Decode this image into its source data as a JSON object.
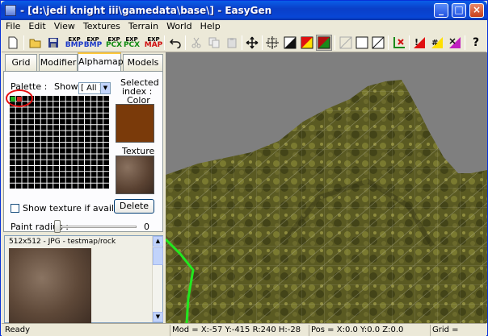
{
  "window": {
    "title": "- [d:\\jedi knight iii\\gamedata\\base\\] - EasyGen"
  },
  "menu": [
    "File",
    "Edit",
    "View",
    "Textures",
    "Terrain",
    "World",
    "Help"
  ],
  "toolbar": {
    "bmp_label": "BMP",
    "exp_label": "EXP",
    "pcx_label": "PCX",
    "map_label": "MAP"
  },
  "tabs": [
    {
      "label": "Grid"
    },
    {
      "label": "Modifier"
    },
    {
      "label": "Alphamap"
    },
    {
      "label": "Models"
    }
  ],
  "alphamap": {
    "palette_label": "Palette :",
    "show_label": "Show :",
    "show_value": "[ All ]",
    "selected_label": "Selected",
    "index_label": "index :",
    "color_label": "Color",
    "texture_label": "Texture",
    "show_texture_label": "Show texture if available",
    "delete_label": "Delete",
    "paint_radius_label": "Paint radius :",
    "paint_radius_value": "0",
    "color_hex": "#7a3a0a"
  },
  "preview": {
    "caption": "512x512 - JPG - testmap/rock"
  },
  "status": {
    "ready": "Ready",
    "mod": "Mod = X:-57 Y:-415 R:240 H:-28",
    "pos": "Pos = X:0.0 Y:0.0 Z:0.0",
    "grid": "Grid ="
  }
}
